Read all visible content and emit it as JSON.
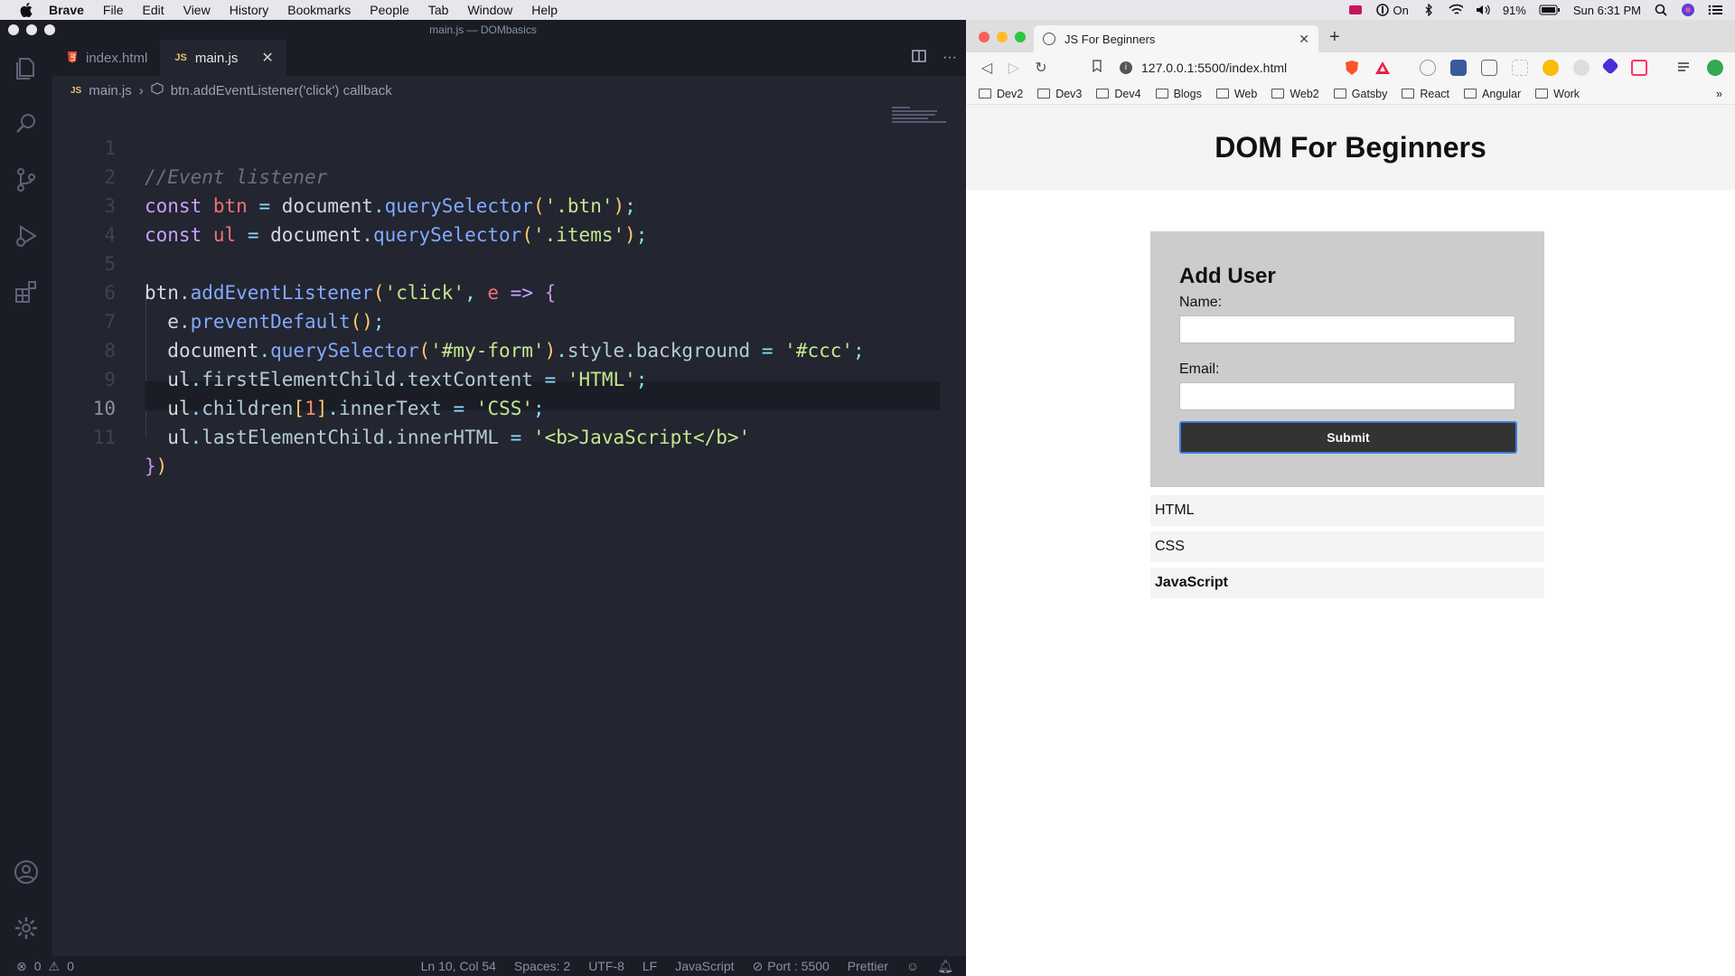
{
  "menubar": {
    "app": "Brave",
    "items": [
      "File",
      "Edit",
      "View",
      "History",
      "Bookmarks",
      "People",
      "Tab",
      "Window",
      "Help"
    ],
    "vpn_label": "On",
    "battery": "91%",
    "clock": "Sun 6:31 PM"
  },
  "vscode": {
    "window_title": "main.js — DOMbasics",
    "tabs": [
      {
        "label": "index.html",
        "icon": "html5-icon"
      },
      {
        "label": "main.js",
        "icon": "js-icon"
      }
    ],
    "breadcrumb": {
      "file": "main.js",
      "symbol": "btn.addEventListener('click') callback"
    },
    "line_numbers": [
      "1",
      "2",
      "3",
      "4",
      "5",
      "6",
      "7",
      "8",
      "9",
      "10",
      "11"
    ],
    "status": {
      "errors": "0",
      "warnings": "0",
      "position": "Ln 10, Col 54",
      "spaces": "Spaces: 2",
      "encoding": "UTF-8",
      "eol": "LF",
      "language": "JavaScript",
      "port": "Port : 5500",
      "formatter": "Prettier"
    },
    "code": {
      "l1": "//Event listener",
      "l2_kw": "const",
      "l2_var": "btn",
      "l2_eq": "=",
      "l2_obj": "document",
      "l2_fn": "querySelector",
      "l2_str": "'.btn'",
      "l3_kw": "const",
      "l3_var": "ul",
      "l3_eq": "=",
      "l3_obj": "document",
      "l3_fn": "querySelector",
      "l3_str": "'.items'",
      "l5_obj": "btn",
      "l5_fn": "addEventListener",
      "l5_str": "'click'",
      "l5_param": "e",
      "l5_arrow": "=>",
      "l6_obj": "e",
      "l6_fn": "preventDefault",
      "l7_obj": "document",
      "l7_fn": "querySelector",
      "l7_str": "'#my-form'",
      "l7_prop": "style",
      "l7_prop2": "background",
      "l7_eq": "=",
      "l7_val": "'#ccc'",
      "l8_obj": "ul",
      "l8_prop": "firstElementChild",
      "l8_prop2": "textContent",
      "l8_eq": "=",
      "l8_val": "'HTML'",
      "l9_obj": "ul",
      "l9_prop": "children",
      "l9_idx": "1",
      "l9_prop2": "innerText",
      "l9_eq": "=",
      "l9_val": "'CSS'",
      "l10_obj": "ul",
      "l10_prop": "lastElementChild",
      "l10_prop2": "innerHTML",
      "l10_eq": "=",
      "l10_val": "'<b>JavaScript</b>'"
    }
  },
  "browser": {
    "tab_title": "JS For Beginners",
    "url": "127.0.0.1:5500/index.html",
    "bookmarks": [
      "Dev2",
      "Dev3",
      "Dev4",
      "Blogs",
      "Web",
      "Web2",
      "Gatsby",
      "React",
      "Angular",
      "Work"
    ],
    "page": {
      "heading": "DOM For Beginners",
      "form_title": "Add User",
      "name_label": "Name:",
      "email_label": "Email:",
      "submit_label": "Submit",
      "items": [
        "HTML",
        "CSS",
        "JavaScript"
      ]
    }
  }
}
